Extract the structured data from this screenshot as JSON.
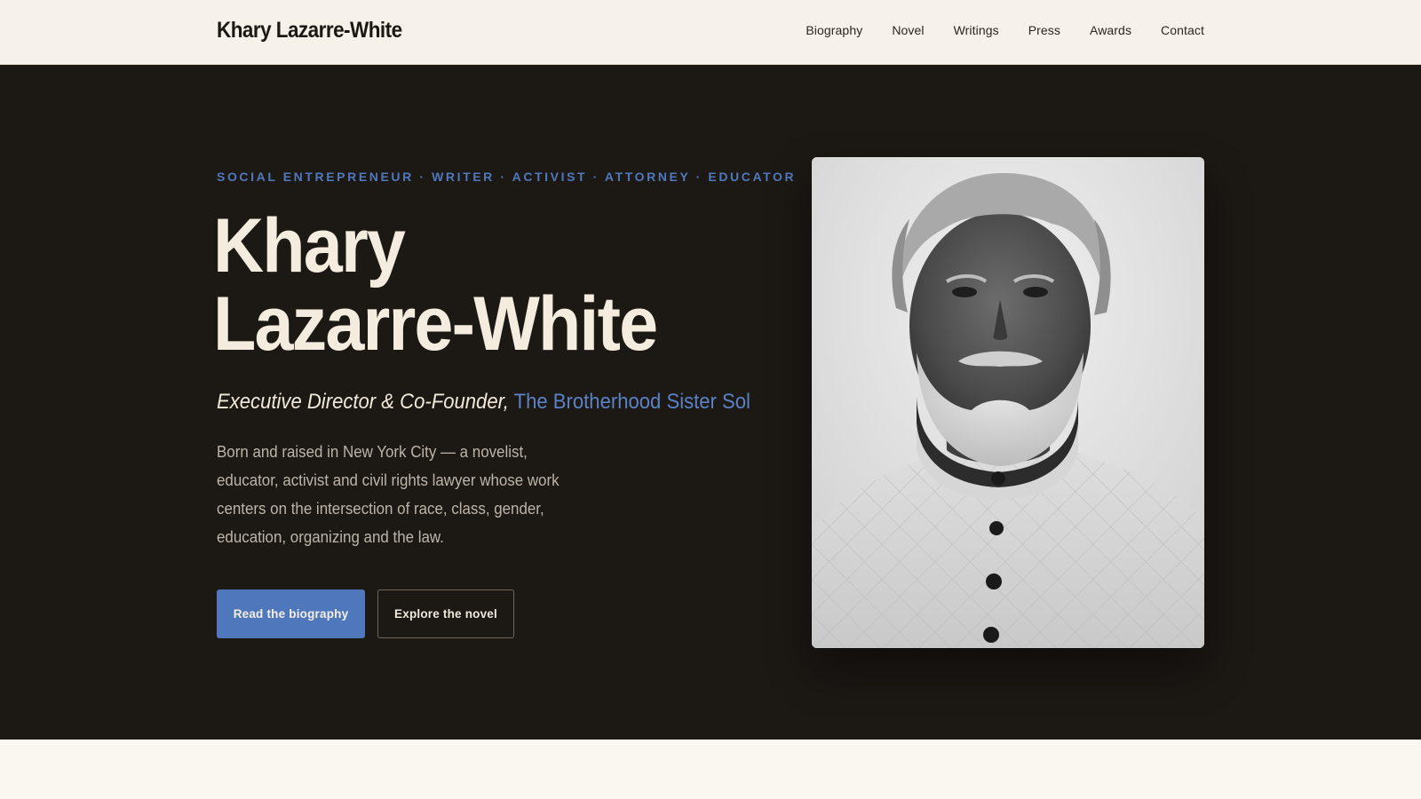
{
  "nav": {
    "brand": "Khary Lazarre-White",
    "links": [
      "Biography",
      "Novel",
      "Writings",
      "Press",
      "Awards",
      "Contact"
    ]
  },
  "hero": {
    "eyebrow": "SOCIAL ENTREPRENEUR · WRITER · ACTIVIST · ATTORNEY · EDUCATOR",
    "title_line1": "Khary",
    "title_line2": "Lazarre-White",
    "subtitle_role": "Executive Director & Co-Founder,",
    "subtitle_org": "The Brotherhood Sister Sol",
    "description": "Born and raised in New York City — a novelist, educator, activist and civil rights lawyer whose work centers on the intersection of race, class, gender, education, organizing and the law.",
    "primary_button": "Read the biography",
    "secondary_button": "Explore the novel"
  },
  "colors": {
    "nav_background": "#f6f2ea",
    "hero_background": "#1c1814",
    "accent_blue": "#4f77bb",
    "title_cream": "#f3ecdf"
  }
}
